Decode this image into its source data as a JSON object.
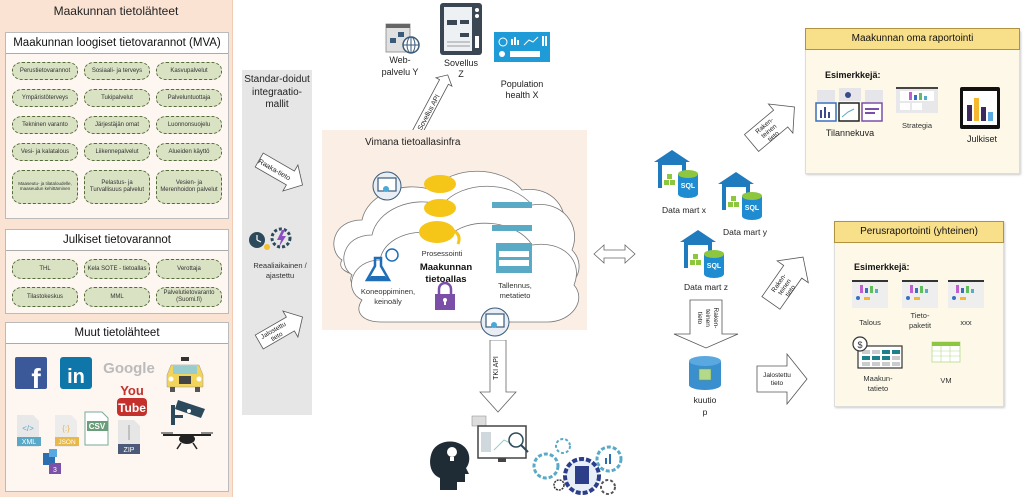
{
  "left_panel": {
    "title": "Maakunnan tietolähteet",
    "mva": {
      "title": "Maakunnan loogiset tietovarannot (MVA)",
      "items": [
        "Perustietovarannot",
        "Sosiaali- ja terveys",
        "Kasvupalvelut",
        "Ympäristöterveys",
        "Tukipalvelut",
        "Palveluntuottaja",
        "Tekninen varanto",
        "Järjestäjän omat",
        "Luonnonsuojelu",
        "Vesi- ja kalatalous",
        "Liikennepalvelut",
        "Alueiden käyttö",
        "Maaseutu- ja tilataloudelle, maaseudun kehittäminen",
        "Pelastus- ja Turvallisuus palvelut",
        "Vesien- ja Merenhoidon palvelut"
      ]
    },
    "public": {
      "title": "Julkiset tietovarannot",
      "items": [
        "THL",
        "Kela SOTE - tietoallas",
        "Verottaja",
        "Tilastokeskus",
        "MML",
        "Palvelutietovaranto (Suomi.fi)"
      ]
    },
    "other": {
      "title": "Muut tietolähteet",
      "icons": [
        "facebook-icon",
        "linkedin-icon",
        "google-icon",
        "youtube-icon",
        "taxi-icon",
        "cctv-camera-icon",
        "drone-icon",
        "xml-file-icon",
        "json-file-icon",
        "csv-file-icon",
        "zip-file-icon",
        "azure-data-icon"
      ],
      "labels": {
        "google": "Google",
        "youtube_top": "You",
        "youtube_bottom": "Tube",
        "xml": "XML",
        "json": "JSON",
        "csv": "CSV",
        "zip": "ZIP",
        "azure": "3"
      }
    }
  },
  "integration": {
    "title": "Standar-doidut integraatio-mallit",
    "raw_arrow": "Raaka-tieto",
    "schedule_label": "Reaaliaikainen / ajastettu",
    "refined_arrow_line1": "Jalostettu",
    "refined_arrow_line2": "tieto"
  },
  "apps": {
    "web_service": "Web-palvelu Y",
    "web_line1": "Web-",
    "web_line2": "palvelu Y",
    "app_line1": "Sovellus",
    "app_line2": "Z",
    "pop_line1": "Population",
    "pop_line2": "health X",
    "api_arrow": "Sovellus API"
  },
  "lake": {
    "title": "Vimana tietoallasinfra",
    "processing": "Prosessointi",
    "name_line1": "Maakunnan",
    "name_line2": "tietoallas",
    "ml_line1": "Koneoppiminen,",
    "ml_line2": "keinoäly",
    "storage_line1": "Tallennus,",
    "storage_line2": "metatieto",
    "tki_arrow": "TKI API"
  },
  "data_marts": {
    "items": [
      "Data mart x",
      "Data mart y",
      "Data mart z"
    ],
    "sql_label": "SQL",
    "down_arrow_lines": [
      "Raken-",
      "teinen",
      "tieto"
    ],
    "cube_line1": "kuutio",
    "cube_line2": "p",
    "refined_line1": "Jalostettu",
    "refined_line2": "tieto",
    "structured_arrow_lines": [
      "Raken-",
      "teinen",
      "tieto"
    ]
  },
  "reporting_own": {
    "title": "Maakunnan oma raportointi",
    "examples_label": "Esimerkkejä:",
    "items": [
      "Tilannekuva",
      "Strategia",
      "Julkiset"
    ]
  },
  "reporting_basic": {
    "title": "Perusraportointi (yhteinen)",
    "examples_label": "Esimerkkejä:",
    "items": [
      "Talous",
      "Tieto-paketit",
      "xxx",
      "Maakun-tatieto",
      "VM"
    ],
    "tieto_line1": "Tieto-",
    "tieto_line2": "paketit",
    "maak_line1": "Maakun-",
    "maak_line2": "tatieto"
  },
  "colors": {
    "left_bg": "#fbe3d4",
    "pill_fill": "#d9e2c3",
    "lake_bg": "#fbeee4",
    "report_head": "#f8df8a",
    "report_bg": "#fdf8e8",
    "azure_blue": "#3a8fcf",
    "hadoop_yellow": "#f5c518",
    "lock_purple": "#7b4fa8"
  }
}
